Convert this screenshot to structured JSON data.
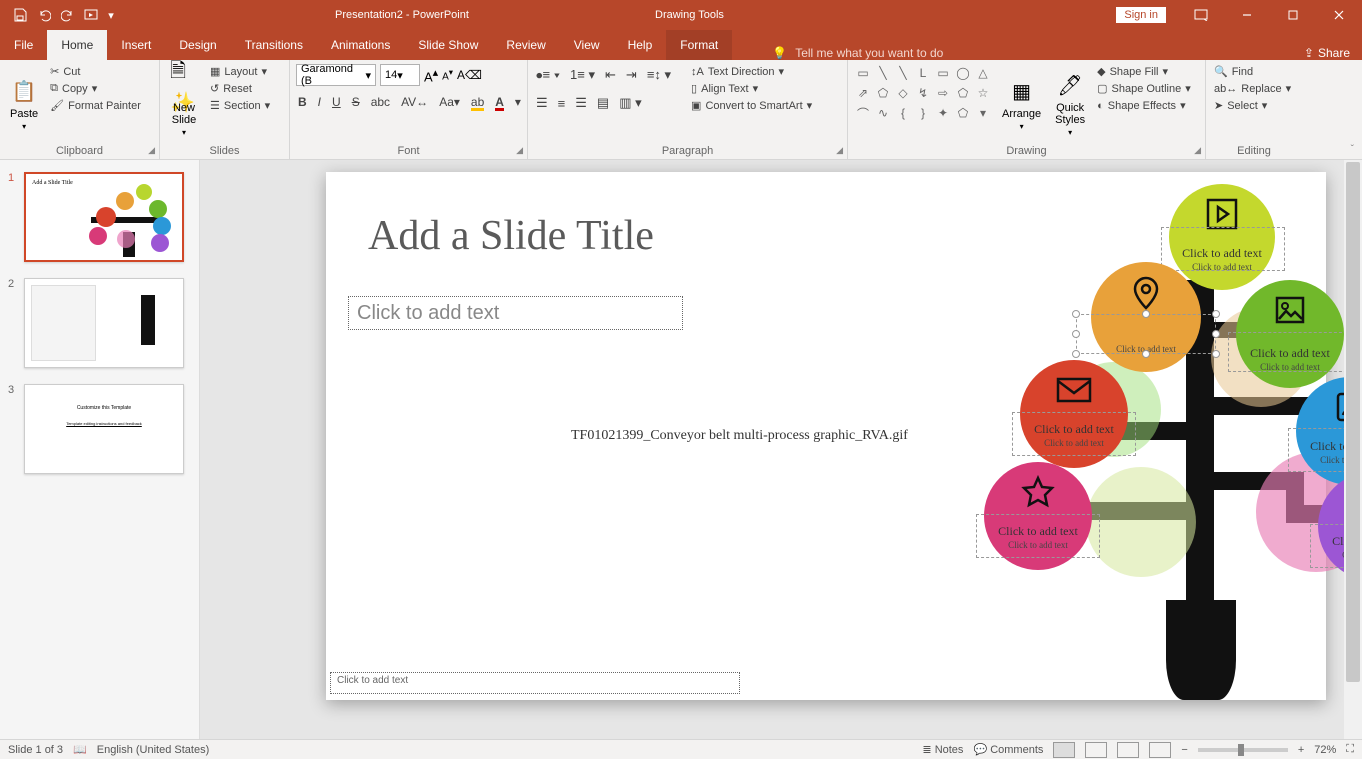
{
  "titlebar": {
    "title": "Presentation2 - PowerPoint",
    "context_tool": "Drawing Tools",
    "signin": "Sign in"
  },
  "tabs": {
    "file": "File",
    "home": "Home",
    "insert": "Insert",
    "design": "Design",
    "transitions": "Transitions",
    "animations": "Animations",
    "slideshow": "Slide Show",
    "review": "Review",
    "view": "View",
    "help": "Help",
    "format": "Format",
    "tellme": "Tell me what you want to do",
    "share": "Share"
  },
  "ribbon": {
    "clipboard": {
      "label": "Clipboard",
      "paste": "Paste",
      "cut": "Cut",
      "copy": "Copy",
      "format_painter": "Format Painter"
    },
    "slides": {
      "label": "Slides",
      "new_slide": "New\nSlide",
      "layout": "Layout",
      "reset": "Reset",
      "section": "Section"
    },
    "font": {
      "label": "Font",
      "name": "Garamond (B",
      "size": "14"
    },
    "paragraph": {
      "label": "Paragraph",
      "text_direction": "Text Direction",
      "align_text": "Align Text",
      "smartart": "Convert to SmartArt"
    },
    "drawing": {
      "label": "Drawing",
      "arrange": "Arrange",
      "quick_styles": "Quick\nStyles",
      "shape_fill": "Shape Fill",
      "shape_outline": "Shape Outline",
      "shape_effects": "Shape Effects"
    },
    "editing": {
      "label": "Editing",
      "find": "Find",
      "replace": "Replace",
      "select": "Select"
    }
  },
  "thumbs": {
    "n1": "1",
    "n2": "2",
    "n3": "3",
    "t1_title": "Add a Slide Title",
    "t3_title": "Customize this Template",
    "t3_sub": "Template editing instructions and feedback"
  },
  "slide": {
    "title": "Add a Slide Title",
    "subtitle_ph": "Click to add text",
    "footer_ph": "Click to add text",
    "center_text": "TF01021399_Conveyor belt multi-process graphic_RVA.gif",
    "add_text": "Click to add text"
  },
  "status": {
    "page": "Slide 1 of 3",
    "lang": "English (United States)",
    "notes": "Notes",
    "comments": "Comments",
    "zoom": "72%"
  }
}
